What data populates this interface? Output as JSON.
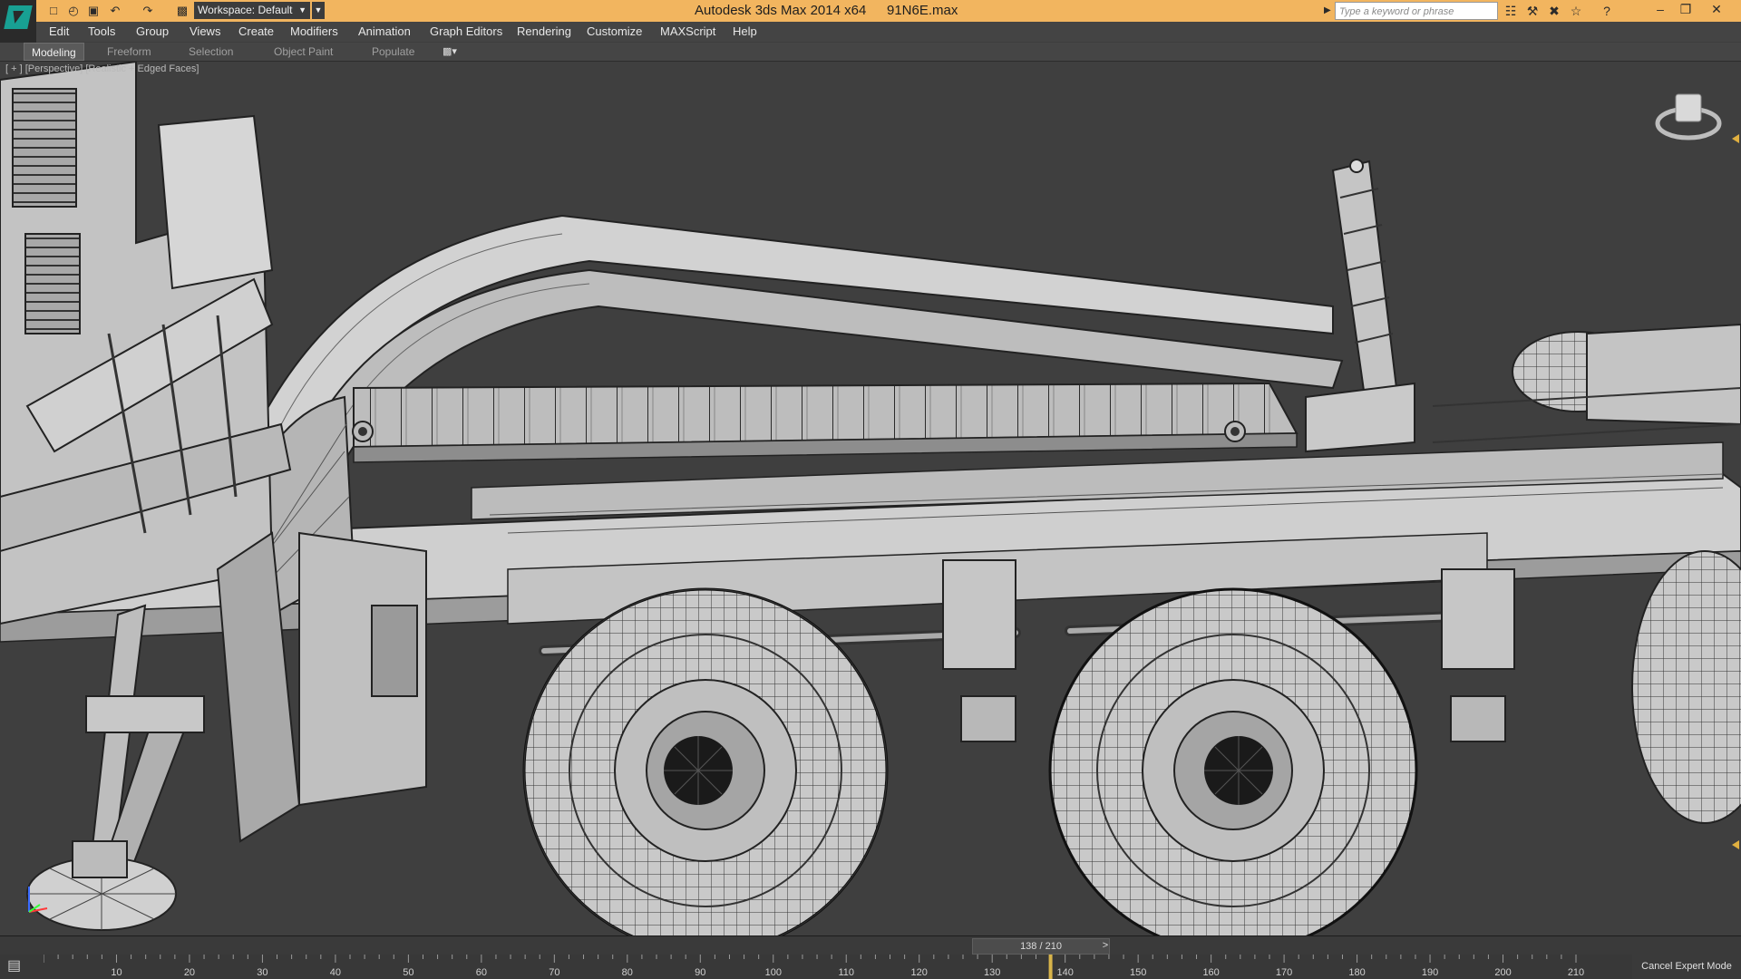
{
  "titlebar": {
    "app_title": "Autodesk 3ds Max  2014 x64",
    "file_name": "91N6E.max",
    "workspace": "Workspace: Default",
    "search_placeholder": "Type a keyword or phrase",
    "accent_color": "#f2b55f"
  },
  "menu": {
    "items": [
      "Edit",
      "Tools",
      "Group",
      "Views",
      "Create",
      "Modifiers",
      "Animation",
      "Graph Editors",
      "Rendering",
      "Customize",
      "MAXScript",
      "Help"
    ]
  },
  "ribbon": {
    "tabs": [
      "Modeling",
      "Freeform",
      "Selection",
      "Object Paint",
      "Populate"
    ],
    "active_tab": "Modeling"
  },
  "viewport": {
    "label": "[ + ] [Perspective] [Realistic + Edged Faces]",
    "background_color": "#3f3f3f",
    "model_color": "#c9c9c9",
    "edge_color": "#202020"
  },
  "timeline": {
    "frame_readout": "138 / 210",
    "current_frame": 138,
    "total_frames": 210,
    "ruler_labels": [
      "10",
      "20",
      "30",
      "40",
      "50",
      "60",
      "70",
      "80",
      "90",
      "100",
      "110",
      "120",
      "130",
      "140",
      "150",
      "160",
      "170",
      "180",
      "190",
      "200",
      "210"
    ]
  },
  "status": {
    "expert_mode_label": "Cancel Expert Mode"
  },
  "icons": {
    "app": "3ds-max-logo-icon",
    "quick_access": [
      "new-file-icon",
      "open-file-icon",
      "save-icon",
      "undo-icon",
      "redo-icon",
      "project-folder-icon"
    ],
    "info_center": [
      "infocenter-icon",
      "subscription-icon",
      "communication-icon",
      "favorites-star-icon",
      "help-icon"
    ],
    "viewcube": "viewcube-icon",
    "axis": "axis-tripod-icon"
  }
}
